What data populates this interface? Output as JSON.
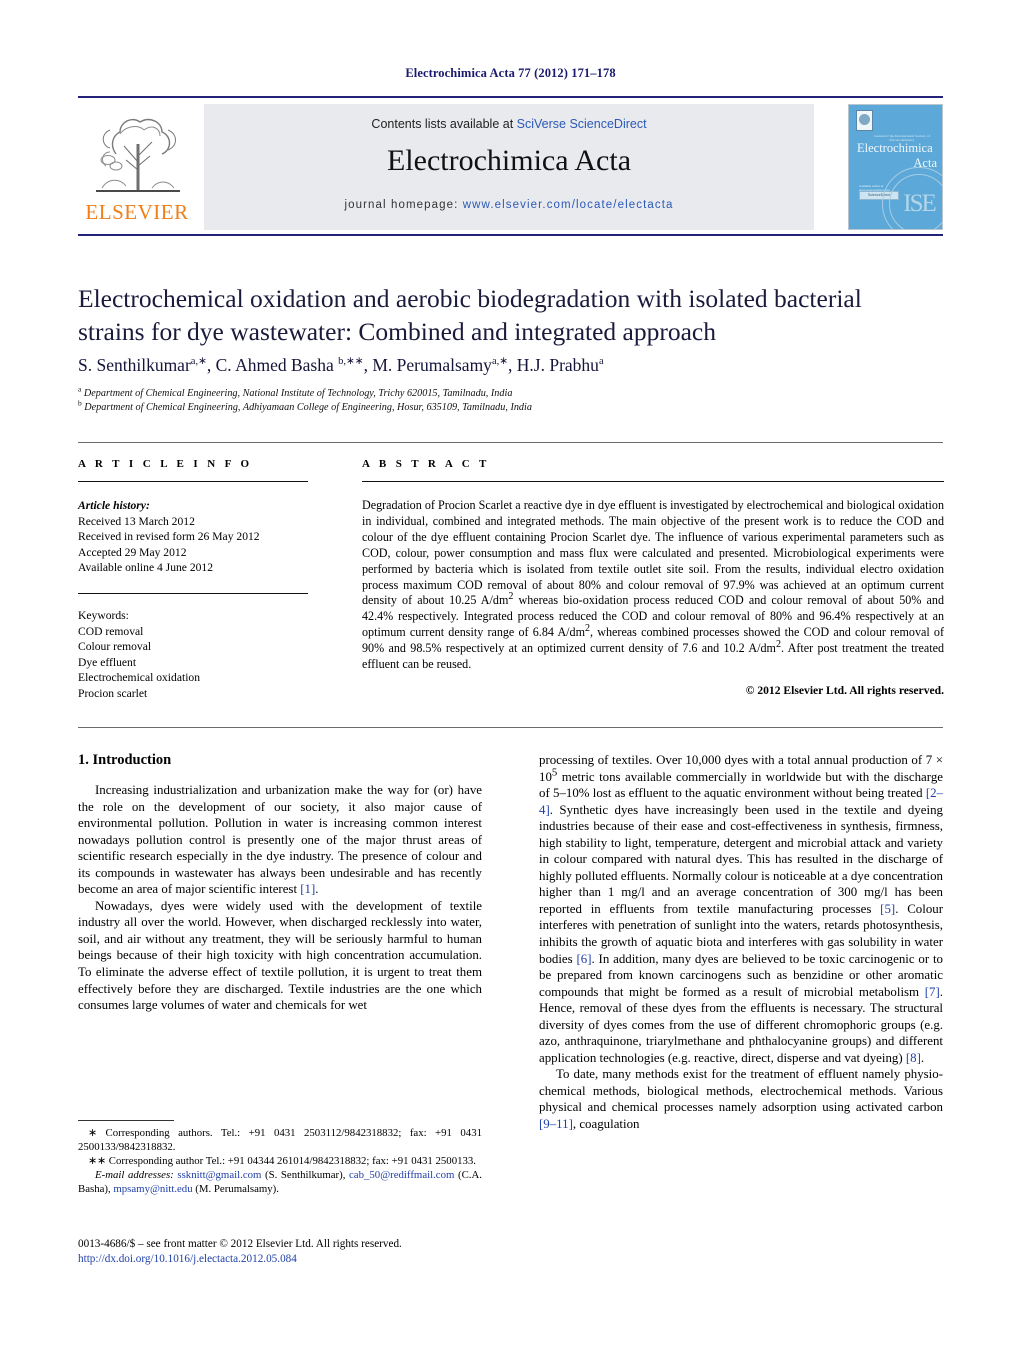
{
  "running_head": "Electrochimica Acta 77 (2012) 171–178",
  "masthead": {
    "contents_prefix": "Contents lists available at ",
    "contents_link": "SciVerse ScienceDirect",
    "journal_name": "Electrochimica Acta",
    "homepage_prefix": "journal homepage: ",
    "homepage_url": "www.elsevier.com/locate/electacta",
    "publisher_logo_text": "ELSEVIER",
    "cover": {
      "society_line": "Journal of the International Society of Electrochemistry",
      "title_line1": "Electrochimica",
      "title_line2": "Acta",
      "badge_text": "ScienceDirect",
      "tag_text": "Available online at www.sciencedirect.com",
      "seal_text": "ISE"
    }
  },
  "article": {
    "title": "Electrochemical oxidation and aerobic biodegradation with isolated bacterial strains for dye wastewater: Combined and integrated approach",
    "authors_html": "S. Senthilkumar<sup>a,∗</sup>, C. Ahmed Basha <sup>b,∗∗</sup>, M. Perumalsamy<sup>a,∗</sup>, H.J. Prabhu<sup>a</sup>",
    "affiliations": [
      "Department of Chemical Engineering, National Institute of Technology, Trichy 620015, Tamilnadu, India",
      "Department of Chemical Engineering, Adhiyamaan College of Engineering, Hosur, 635109, Tamilnadu, India"
    ]
  },
  "article_info": {
    "heading": "A R T I C L E    I N F O",
    "history_label": "Article history:",
    "history": [
      "Received 13 March 2012",
      "Received in revised form 26 May 2012",
      "Accepted 29 May 2012",
      "Available online 4 June 2012"
    ],
    "keywords_label": "Keywords:",
    "keywords": [
      "COD removal",
      "Colour removal",
      "Dye effluent",
      "Electrochemical oxidation",
      "Procion scarlet"
    ]
  },
  "abstract": {
    "heading": "A B S T R A C T",
    "text_html": "Degradation of Procion Scarlet a reactive dye in dye effluent is investigated by electrochemical and biological oxidation in individual, combined and integrated methods. The main objective of the present work is to reduce the COD and colour of the dye effluent containing Procion Scarlet dye. The influence of various experimental parameters such as COD, colour, power consumption and mass flux were calculated and presented. Microbiological experiments were performed by bacteria which is isolated from textile outlet site soil. From the results, individual electro oxidation process maximum COD removal of about 80% and colour removal of 97.9% was achieved at an optimum current density of about 10.25 A/dm<sup>2</sup> whereas bio-oxidation process reduced COD and colour removal of about 50% and 42.4% respectively. Integrated process reduced the COD and colour removal of 80% and 96.4% respectively at an optimum current density range of 6.84 A/dm<sup>2</sup>, whereas combined processes showed the COD and colour removal of 90% and 98.5% respectively at an optimized current density of 7.6 and 10.2 A/dm<sup>2</sup>. After post treatment the treated effluent can be reused.",
    "copyright": "© 2012 Elsevier Ltd. All rights reserved."
  },
  "body": {
    "section_heading": "1.  Introduction",
    "left_paragraphs_html": [
      "Increasing industrialization and urbanization make the way for (or) have the role on the development of our society, it also major cause of environmental pollution. Pollution in water is increasing common interest nowadays pollution control is presently one of the major thrust areas of scientific research especially in the dye industry. The presence of colour and its compounds in wastewater has always been undesirable and has recently become an area of major scientific interest <span class=\"ref\">[1]</span>.",
      "Nowadays, dyes were widely used with the development of textile industry all over the world. However, when discharged recklessly into water, soil, and air without any treatment, they will be seriously harmful to human beings because of their high toxicity with high concentration accumulation. To eliminate the adverse effect of textile pollution, it is urgent to treat them effectively before they are discharged. Textile industries are the one which consumes large volumes of water and chemicals for wet"
    ],
    "right_paragraphs_html": [
      "processing of textiles. Over 10,000 dyes with a total annual production of 7 × 10<sup>5</sup> metric tons available commercially in worldwide but with the discharge of 5–10% lost as effluent to the aquatic environment without being treated <span class=\"ref\">[2–4]</span>. Synthetic dyes have increasingly been used in the textile and dyeing industries because of their ease and cost-effectiveness in synthesis, firmness, high stability to light, temperature, detergent and microbial attack and variety in colour compared with natural dyes. This has resulted in the discharge of highly polluted effluents. Normally colour is noticeable at a dye concentration higher than 1 mg/l and an average concentration of 300 mg/l has been reported in effluents from textile manufacturing processes <span class=\"ref\">[5]</span>. Colour interferes with penetration of sunlight into the waters, retards photosynthesis, inhibits the growth of aquatic biota and interferes with gas solubility in water bodies <span class=\"ref\">[6]</span>. In addition, many dyes are believed to be toxic carcinogenic or to be prepared from known carcinogens such as benzidine or other aromatic compounds that might be formed as a result of microbial metabolism <span class=\"ref\">[7]</span>. Hence, removal of these dyes from the effluents is necessary. The structural diversity of dyes comes from the use of different chromophoric groups (e.g. azo, anthraquinone, triarylmethane and phthalocyanine groups) and different application technologies (e.g. reactive, direct, disperse and vat dyeing) <span class=\"ref\">[8]</span>.",
      "To date, many methods exist for the treatment of effluent namely physio-chemical methods, biological methods, electrochemical methods. Various physical and chemical processes namely adsorption using activated carbon <span class=\"ref\">[9–11]</span>, coagulation"
    ]
  },
  "footnotes": {
    "corresponding_1_html": "<span>∗</span> Corresponding authors. Tel.: +91 0431 2503112/9842318832; fax: +91 0431 2500133/9842318832.",
    "corresponding_2_html": "<span>∗∗</span> Corresponding author Tel.: +91 04344 261014/9842318832; fax: +91 0431 2500133.",
    "email_label": "E-mail addresses:",
    "emails_html": "<span class=\"mail\">ssknitt@gmail.com</span> (S. Senthilkumar), <span class=\"mail\">cab_50@rediffmail.com</span> (C.A. Basha), <span class=\"mail\">mpsamy@nitt.edu</span> (M. Perumalsamy)."
  },
  "imprint": {
    "line1": "0013-4686/$ – see front matter © 2012 Elsevier Ltd. All rights reserved.",
    "doi": "http://dx.doi.org/10.1016/j.electacta.2012.05.084"
  }
}
